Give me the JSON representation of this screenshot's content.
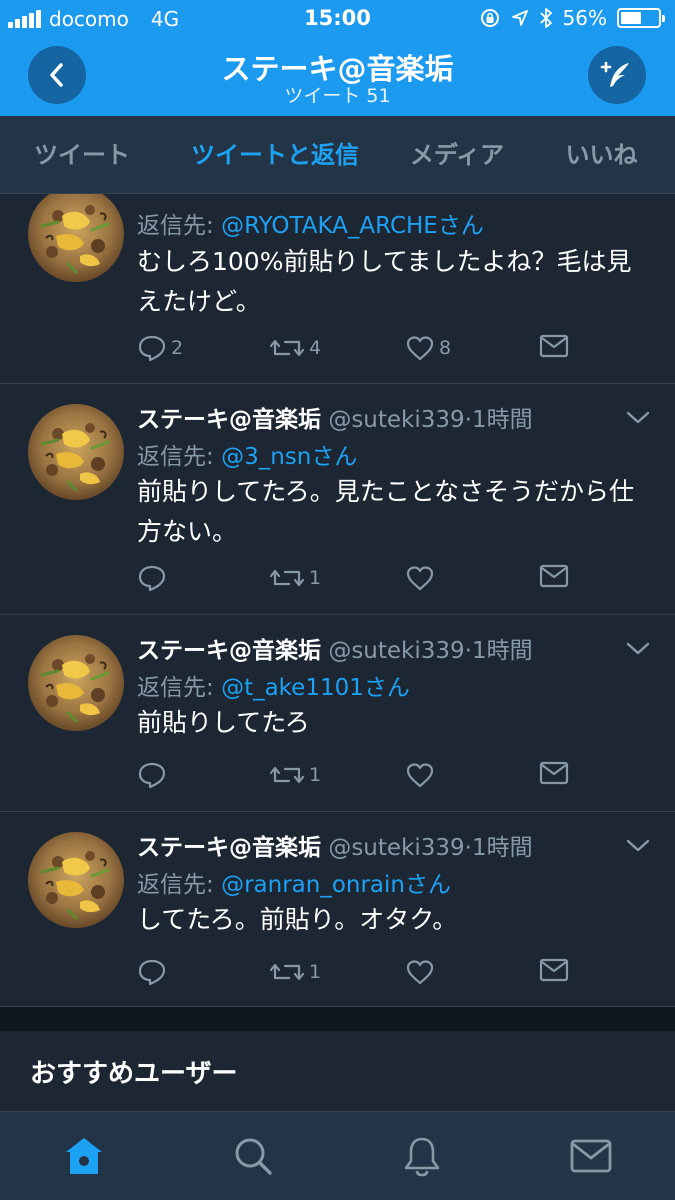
{
  "status_bar": {
    "carrier": "docomo",
    "network": "4G",
    "time": "15:00",
    "battery_text": "56%",
    "battery_level": 0.56
  },
  "header": {
    "title": "ステーキ@音楽垢",
    "subtitle": "ツイート 51"
  },
  "tabs": [
    {
      "label": "ツイート",
      "active": false
    },
    {
      "label": "ツイートと返信",
      "active": true
    },
    {
      "label": "メディア",
      "active": false
    },
    {
      "label": "いいね",
      "active": false
    }
  ],
  "tweets": [
    {
      "name": "",
      "handle": "",
      "time": "",
      "reply_prefix": "返信先: ",
      "reply_to": "@RYOTAKA_ARCHEさん",
      "body": "むしろ100%前貼りしてましたよね？毛は見えたけど。",
      "replies": "2",
      "retweets": "4",
      "likes": "8"
    },
    {
      "name": "ステーキ@音楽垢",
      "handle": "@suteki339",
      "time": "·1時間",
      "reply_prefix": "返信先: ",
      "reply_to": "@3_nsnさん",
      "body": "前貼りしてたろ。見たことなさそうだから仕方ない。",
      "replies": "",
      "retweets": "1",
      "likes": ""
    },
    {
      "name": "ステーキ@音楽垢",
      "handle": "@suteki339",
      "time": "·1時間",
      "reply_prefix": "返信先: ",
      "reply_to": "@t_ake1101さん",
      "body": "前貼りしてたろ",
      "replies": "",
      "retweets": "1",
      "likes": ""
    },
    {
      "name": "ステーキ@音楽垢",
      "handle": "@suteki339",
      "time": "·1時間",
      "reply_prefix": "返信先: ",
      "reply_to": "@ranran_onrainさん",
      "body": "してたろ。前貼り。オタク。",
      "replies": "",
      "retweets": "1",
      "likes": ""
    }
  ],
  "recommended": {
    "title": "おすすめユーザー"
  },
  "bottom_nav": [
    {
      "icon": "home-icon",
      "active": true
    },
    {
      "icon": "search-icon",
      "active": false
    },
    {
      "icon": "bell-icon",
      "active": false
    },
    {
      "icon": "mail-icon",
      "active": false
    }
  ],
  "colors": {
    "brand_blue": "#1c9af0",
    "link_blue": "#1da1f2",
    "background": "#1c2733",
    "secondary_text": "#8899a6"
  }
}
